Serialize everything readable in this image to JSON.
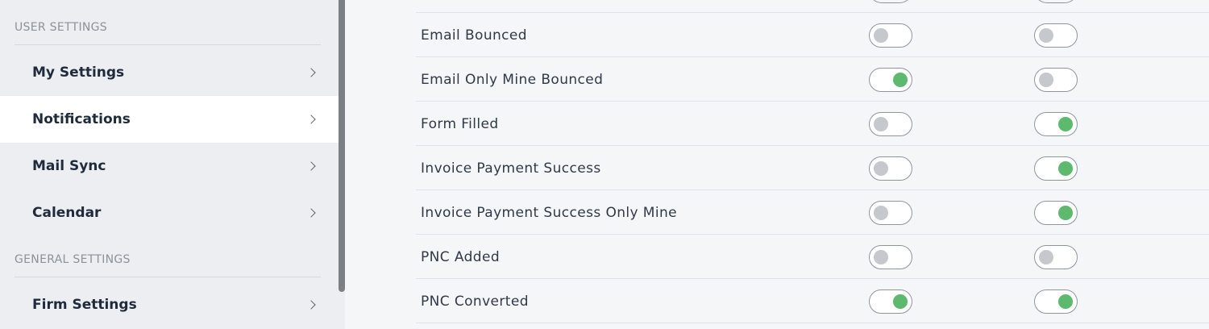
{
  "sidebar": {
    "user_settings_label": "USER SETTINGS",
    "general_settings_label": "GENERAL SETTINGS",
    "items": [
      {
        "label": "My Settings",
        "active": false
      },
      {
        "label": "Notifications",
        "active": true
      },
      {
        "label": "Mail Sync",
        "active": false
      },
      {
        "label": "Calendar",
        "active": false
      },
      {
        "label": "Firm Settings",
        "active": false
      }
    ]
  },
  "notifications": [
    {
      "label": "Email Bounced",
      "col1": false,
      "col2": false
    },
    {
      "label": "Email Only Mine Bounced",
      "col1": true,
      "col2": false
    },
    {
      "label": "Form Filled",
      "col1": false,
      "col2": true
    },
    {
      "label": "Invoice Payment Success",
      "col1": false,
      "col2": true
    },
    {
      "label": "Invoice Payment Success Only Mine",
      "col1": false,
      "col2": true
    },
    {
      "label": "PNC Added",
      "col1": false,
      "col2": false
    },
    {
      "label": "PNC Converted",
      "col1": true,
      "col2": true
    }
  ],
  "colors": {
    "toggle_on": "#5cb96e",
    "toggle_off": "#c5c8cd"
  }
}
